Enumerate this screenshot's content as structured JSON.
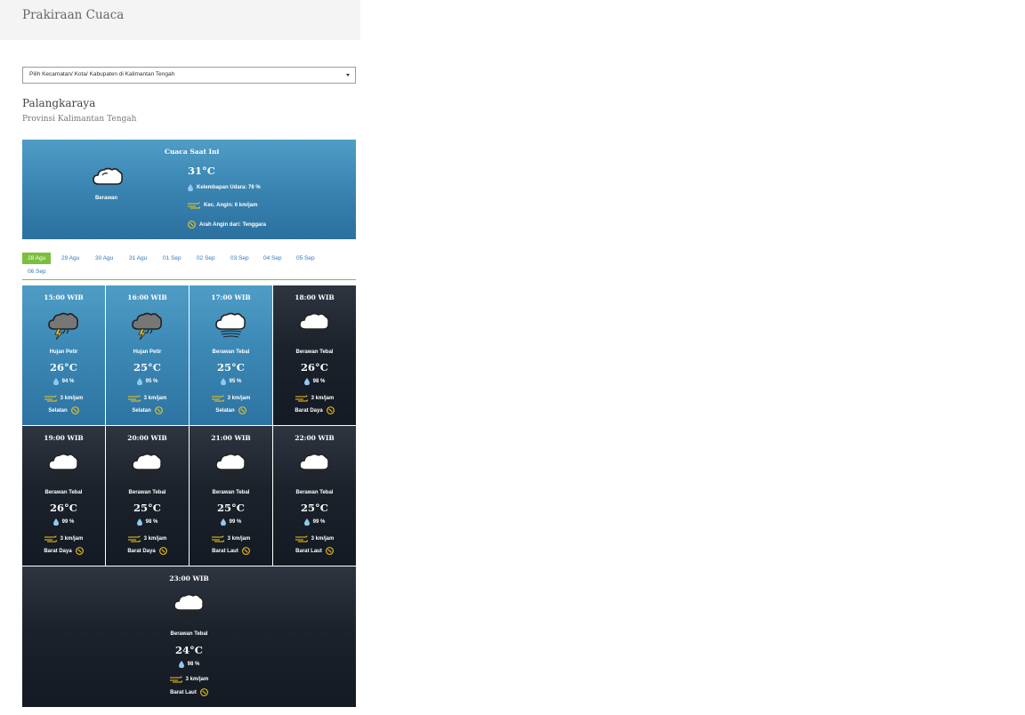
{
  "header": {
    "title": "Prakiraan Cuaca"
  },
  "selector": {
    "value": "Pilih Kecamatan/ Kota/ Kabupaten di Kalimantan Tengah"
  },
  "location": {
    "city": "Palangkaraya",
    "province": "Provinsi Kalimantan Tengah"
  },
  "current": {
    "title": "Cuaca Saat Ini",
    "condition": "Berawan",
    "icon": "cloudy-icon",
    "temp": "31°C",
    "humidity": "Kelembapan Udara: 76 %",
    "wind": "Kec. Angin: 6 km/jam",
    "wind_dir": "Arah Angin dari: Tenggara"
  },
  "tabs": [
    "28 Agu",
    "29 Agu",
    "30 Agu",
    "31 Agu",
    "01 Sep",
    "02 Sep",
    "03 Sep",
    "04 Sep",
    "05 Sep",
    "06 Sep"
  ],
  "active_tab": "28 Agu",
  "forecast": [
    {
      "time": "15:00 WIB",
      "cond": "Hujan Petir",
      "icon": "thunderstorm-icon",
      "temp": "26°C",
      "hum": "94 %",
      "wind": "3 km/jam",
      "dir": "Selatan",
      "theme": "day"
    },
    {
      "time": "16:00 WIB",
      "cond": "Hujan Petir",
      "icon": "thunderstorm-icon",
      "temp": "25°C",
      "hum": "95 %",
      "wind": "3 km/jam",
      "dir": "Selatan",
      "theme": "day"
    },
    {
      "time": "17:00 WIB",
      "cond": "Berawan Tebal",
      "icon": "overcast-icon",
      "temp": "25°C",
      "hum": "95 %",
      "wind": "3 km/jam",
      "dir": "Selatan",
      "theme": "day"
    },
    {
      "time": "18:00 WIB",
      "cond": "Berawan Tebal",
      "icon": "overcast-icon",
      "temp": "26°C",
      "hum": "98 %",
      "wind": "3 km/jam",
      "dir": "Barat Daya",
      "theme": "night"
    },
    {
      "time": "19:00 WIB",
      "cond": "Berawan Tebal",
      "icon": "overcast-icon",
      "temp": "26°C",
      "hum": "99 %",
      "wind": "3 km/jam",
      "dir": "Barat Daya",
      "theme": "night"
    },
    {
      "time": "20:00 WIB",
      "cond": "Berawan Tebal",
      "icon": "overcast-icon",
      "temp": "25°C",
      "hum": "98 %",
      "wind": "3 km/jam",
      "dir": "Barat Daya",
      "theme": "night"
    },
    {
      "time": "21:00 WIB",
      "cond": "Berawan Tebal",
      "icon": "overcast-icon",
      "temp": "25°C",
      "hum": "99 %",
      "wind": "3 km/jam",
      "dir": "Barat Laut",
      "theme": "night"
    },
    {
      "time": "22:00 WIB",
      "cond": "Berawan Tebal",
      "icon": "overcast-icon",
      "temp": "25°C",
      "hum": "99 %",
      "wind": "3 km/jam",
      "dir": "Barat Laut",
      "theme": "night"
    },
    {
      "time": "23:00 WIB",
      "cond": "Berawan Tebal",
      "icon": "overcast-icon",
      "temp": "24°C",
      "hum": "98 %",
      "wind": "3 km/jam",
      "dir": "Barat Laut",
      "theme": "night"
    }
  ],
  "colors": {
    "accent": "#7bbf3c",
    "link": "#2e78b8",
    "day_bg": "#3c88b5",
    "night_bg": "#1c222c",
    "wind_icon": "#f5c518"
  }
}
